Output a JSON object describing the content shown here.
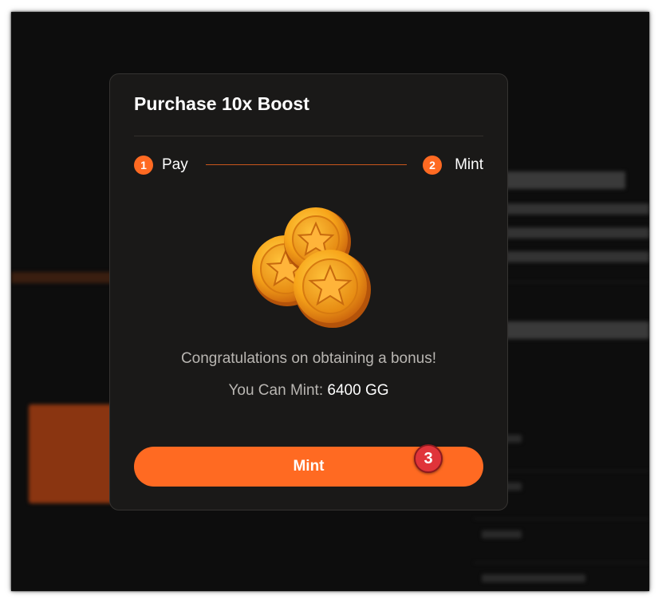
{
  "modal": {
    "title": "Purchase 10x Boost",
    "steps": [
      {
        "number": "1",
        "label": "Pay"
      },
      {
        "number": "2",
        "label": "Mint"
      }
    ],
    "illustration": "gold-coins-icon",
    "message": "Congratulations on obtaining a bonus!",
    "mint_label": "You Can Mint:",
    "mint_value": "6400 GG",
    "button_label": "Mint"
  },
  "annotation": {
    "marker": "3"
  },
  "colors": {
    "accent": "#ff6a22",
    "modal_bg": "#1a1918",
    "page_bg": "#0d0d0d",
    "marker": "#e0343a"
  }
}
